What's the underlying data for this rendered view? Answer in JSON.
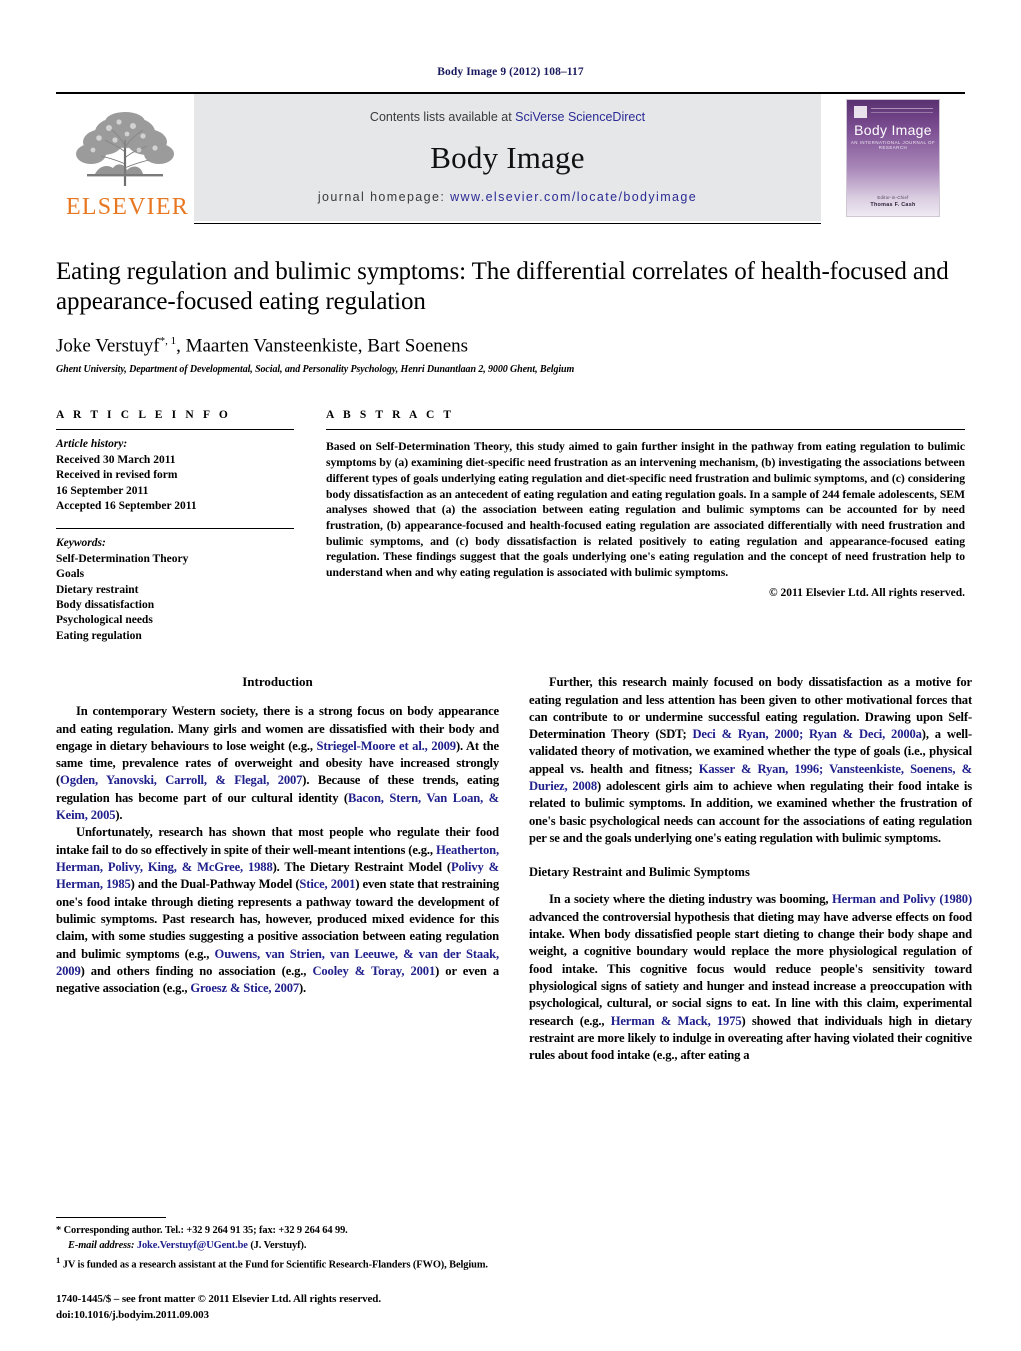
{
  "running_head": "Body Image 9 (2012) 108–117",
  "masthead": {
    "publisher_name": "ELSEVIER",
    "contents_prefix": "Contents lists available at ",
    "contents_link": "SciVerse ScienceDirect",
    "journal_title": "Body Image",
    "homepage_prefix": "journal homepage: ",
    "homepage_url": "www.elsevier.com/locate/bodyimage",
    "cover": {
      "title": "Body Image",
      "subtitle": "AN INTERNATIONAL JOURNAL OF RESEARCH",
      "editor_label": "Editor-in-Chief",
      "editor_name": "Thomas F. Cash"
    },
    "link_color": "#2b2b96",
    "banner_color": "#e6e7e8",
    "elsevier_orange": "#E87722"
  },
  "article": {
    "title": "Eating regulation and bulimic symptoms: The differential correlates of health-focused and appearance-focused eating regulation",
    "authors": "Joke Verstuyf",
    "authors_marks": "*, 1",
    "authors_rest": ", Maarten Vansteenkiste, Bart Soenens",
    "affiliation": "Ghent University, Department of Developmental, Social, and Personality Psychology, Henri Dunantlaan 2, 9000 Ghent, Belgium"
  },
  "article_info": {
    "label": "A R T I C L E   I N F O",
    "history_heading": "Article history:",
    "history": [
      "Received 30 March 2011",
      "Received in revised form",
      "16 September 2011",
      "Accepted 16 September 2011"
    ],
    "keywords_heading": "Keywords:",
    "keywords": [
      "Self-Determination Theory",
      "Goals",
      "Dietary restraint",
      "Body dissatisfaction",
      "Psychological needs",
      "Eating regulation"
    ]
  },
  "abstract": {
    "label": "A B S T R A C T",
    "text": "Based on Self-Determination Theory, this study aimed to gain further insight in the pathway from eating regulation to bulimic symptoms by (a) examining diet-specific need frustration as an intervening mechanism, (b) investigating the associations between different types of goals underlying eating regulation and diet-specific need frustration and bulimic symptoms, and (c) considering body dissatisfaction as an antecedent of eating regulation and eating regulation goals. In a sample of 244 female adolescents, SEM analyses showed that (a) the association between eating regulation and bulimic symptoms can be accounted for by need frustration, (b) appearance-focused and health-focused eating regulation are associated differentially with need frustration and bulimic symptoms, and (c) body dissatisfaction is related positively to eating regulation and appearance-focused eating regulation. These findings suggest that the goals underlying one's eating regulation and the concept of need frustration help to understand when and why eating regulation is associated with bulimic symptoms.",
    "copyright": "© 2011 Elsevier Ltd. All rights reserved."
  },
  "body": {
    "left": {
      "section_heading": "Introduction",
      "paragraphs": [
        {
          "runs": [
            {
              "t": "In contemporary Western society, there is a strong focus on body appearance and eating regulation. Many girls and women are dissatisfied with their body and engage in dietary behaviours to lose weight (e.g., "
            },
            {
              "t": "Striegel-Moore et al., 2009",
              "cite": true
            },
            {
              "t": "). At the same time, prevalence rates of overweight and obesity have increased strongly ("
            },
            {
              "t": "Ogden, Yanovski, Carroll, & Flegal, 2007",
              "cite": true
            },
            {
              "t": "). Because of these trends, eating regulation has become part of our cultural identity ("
            },
            {
              "t": "Bacon, Stern, Van Loan, & Keim, 2005",
              "cite": true
            },
            {
              "t": ")."
            }
          ]
        },
        {
          "runs": [
            {
              "t": "Unfortunately, research has shown that most people who regulate their food intake fail to do so effectively in spite of their well-meant intentions (e.g., "
            },
            {
              "t": "Heatherton, Herman, Polivy, King, & McGree, 1988",
              "cite": true
            },
            {
              "t": "). The Dietary Restraint Model ("
            },
            {
              "t": "Polivy & Herman, 1985",
              "cite": true
            },
            {
              "t": ") and the Dual-Pathway Model ("
            },
            {
              "t": "Stice, 2001",
              "cite": true
            },
            {
              "t": ") even state that restraining one's food intake through dieting represents a pathway toward the development of bulimic symptoms. Past research has, however, produced mixed evidence for this claim, with some studies suggesting a positive association between eating regulation and bulimic symptoms (e.g., "
            },
            {
              "t": "Ouwens, van Strien, van Leeuwe, & van der Staak, 2009",
              "cite": true
            },
            {
              "t": ") and others finding no association (e.g., "
            },
            {
              "t": "Cooley & Toray, 2001",
              "cite": true
            },
            {
              "t": ") or even a negative association (e.g., "
            },
            {
              "t": "Groesz & Stice, 2007",
              "cite": true
            },
            {
              "t": ")."
            }
          ]
        }
      ]
    },
    "right": {
      "paragraphs": [
        {
          "runs": [
            {
              "t": "Further, this research mainly focused on body dissatisfaction as a motive for eating regulation and less attention has been given to other motivational forces that can contribute to or undermine successful eating regulation. Drawing upon Self-Determination Theory (SDT; "
            },
            {
              "t": "Deci & Ryan, 2000; Ryan & Deci, 2000a",
              "cite": true
            },
            {
              "t": "), a well-validated theory of motivation, we examined whether the type of goals (i.e., physical appeal vs. health and fitness; "
            },
            {
              "t": "Kasser & Ryan, 1996; Vansteenkiste, Soenens, & Duriez, 2008",
              "cite": true
            },
            {
              "t": ") adolescent girls aim to achieve when regulating their food intake is related to bulimic symptoms. In addition, we examined whether the frustration of one's basic psychological needs can account for the associations of eating regulation per se and the goals underlying one's eating regulation with bulimic symptoms."
            }
          ],
          "no_indent": false
        }
      ],
      "subsection_heading": "Dietary Restraint and Bulimic Symptoms",
      "paragraphs2": [
        {
          "runs": [
            {
              "t": "In a society where the dieting industry was booming, "
            },
            {
              "t": "Herman and Polivy (1980)",
              "cite": true
            },
            {
              "t": " advanced the controversial hypothesis that dieting may have adverse effects on food intake. When body dissatisfied people start dieting to change their body shape and weight, a cognitive boundary would replace the more physiological regulation of food intake. This cognitive focus would reduce people's sensitivity toward physiological signs of satiety and hunger and instead increase a preoccupation with psychological, cultural, or social signs to eat. In line with this claim, experimental research (e.g., "
            },
            {
              "t": "Herman & Mack, 1975",
              "cite": true
            },
            {
              "t": ") showed that individuals high in dietary restraint are more likely to indulge in overeating after having violated their cognitive rules about food intake (e.g., after eating a"
            }
          ]
        }
      ]
    }
  },
  "footnotes": {
    "corresponding": "* Corresponding author. Tel.: +32 9 264 91 35; fax: +32 9 264 64 99.",
    "email_label": "E-mail address:",
    "email": "Joke.Verstuyf@UGent.be",
    "email_suffix": " (J. Verstuyf).",
    "note1_mark": "1",
    "note1": "JV is funded as a research assistant at the Fund for Scientific Research-Flanders (FWO), Belgium."
  },
  "issn": {
    "line1": "1740-1445/$ – see front matter © 2011 Elsevier Ltd. All rights reserved.",
    "line2": "doi:10.1016/j.bodyim.2011.09.003"
  }
}
